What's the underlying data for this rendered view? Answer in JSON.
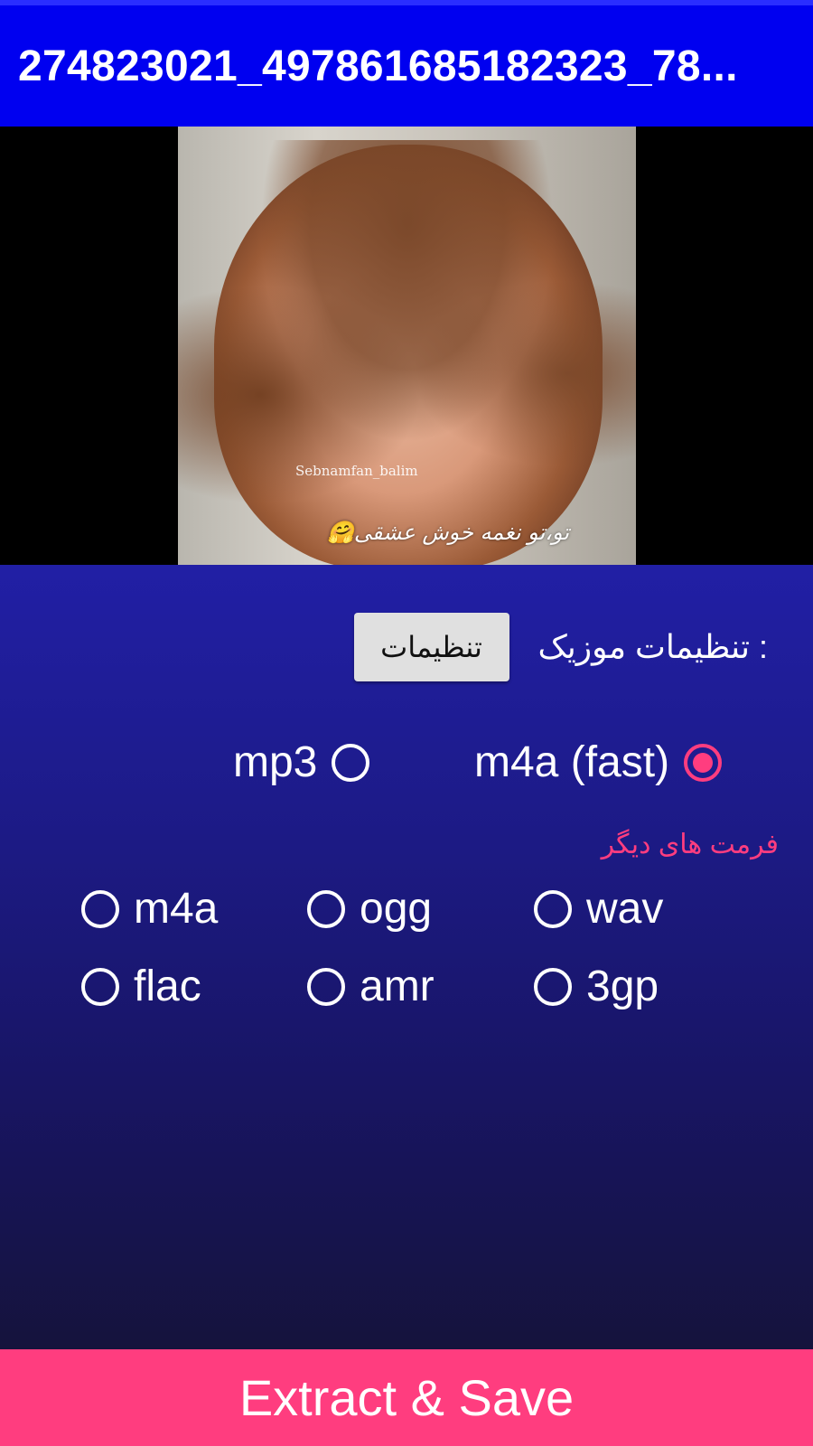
{
  "appbar": {
    "title": "274823021_497861685182323_78..."
  },
  "video": {
    "watermark": "Sebnamfan_balim",
    "caption": "تو،تو نغمه خوش عشقی🤗"
  },
  "settings": {
    "label": ": تنظیمات موزیک",
    "button_label": "تنظیمات"
  },
  "primary_formats": [
    {
      "label": "m4a (fast)",
      "selected": true
    },
    {
      "label": "mp3",
      "selected": false
    }
  ],
  "other_formats": {
    "heading": "فرمت های دیگر",
    "options": [
      {
        "label": "m4a",
        "selected": false
      },
      {
        "label": "ogg",
        "selected": false
      },
      {
        "label": "wav",
        "selected": false
      },
      {
        "label": "flac",
        "selected": false
      },
      {
        "label": "amr",
        "selected": false
      },
      {
        "label": "3gp",
        "selected": false
      }
    ]
  },
  "footer": {
    "action_label": "Extract & Save"
  },
  "colors": {
    "appbar": "#0000f0",
    "accent": "#ff3d7f",
    "panel_top": "#211fa5",
    "panel_bottom": "#15133c"
  }
}
